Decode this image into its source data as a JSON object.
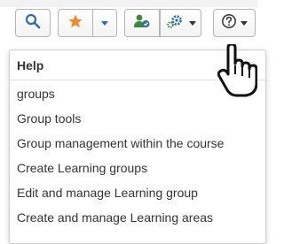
{
  "toolbar": {
    "search_icon": "search-icon",
    "bookmark_icon": "star-icon",
    "group_icon": "user-group-icon",
    "tools_icon": "gears-icon",
    "help_icon": "question-circle-icon",
    "colors": {
      "accent_blue": "#2a6db0",
      "star_orange": "#f08a24",
      "group_green": "#3a8a3a"
    }
  },
  "help_menu": {
    "header": "Help",
    "items": [
      "groups",
      "Group tools",
      "Group management within the course",
      "Create Learning groups",
      "Edit and manage Learning group",
      "Create and manage Learning areas"
    ]
  }
}
